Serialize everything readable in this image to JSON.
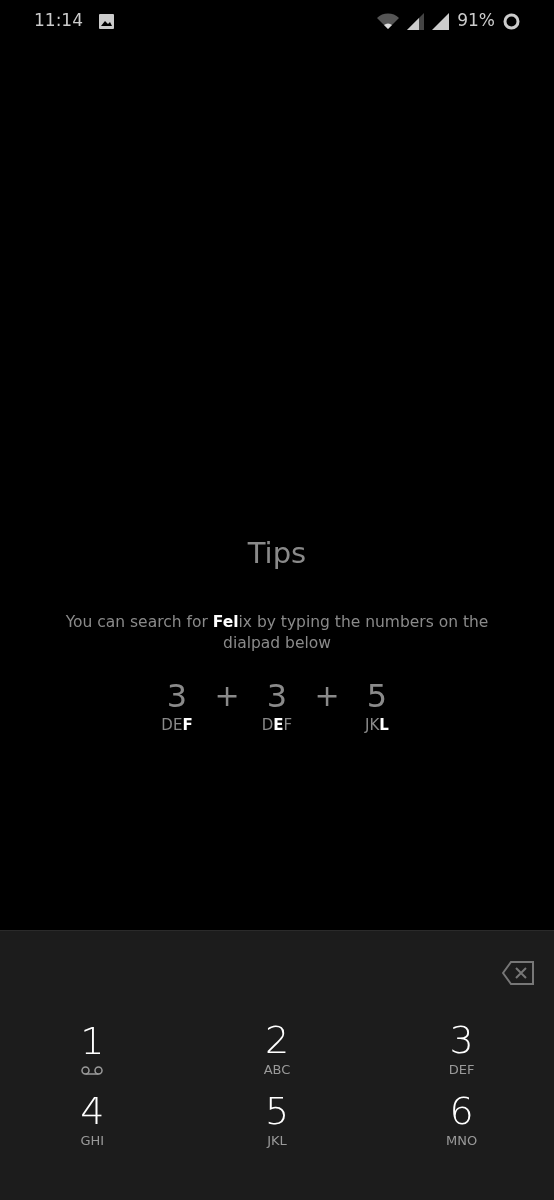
{
  "status_bar": {
    "time": "11:14",
    "battery": "91%"
  },
  "tips": {
    "title": "Tips",
    "message": "You can search for **Fel**ix by typing the numbers on the dialpad below",
    "sequence": [
      {
        "digit": "3",
        "letters": "DE**F**"
      },
      {
        "digit": "3",
        "letters": "D**E**F"
      },
      {
        "digit": "5",
        "letters": "JK**L**"
      }
    ],
    "joiner": [
      "+",
      "+"
    ]
  },
  "dialpad": {
    "keys": [
      {
        "digit": "1",
        "kind": "voicemail"
      },
      {
        "digit": "2",
        "kind": "letters",
        "letters": "ABC"
      },
      {
        "digit": "3",
        "kind": "letters",
        "letters": "DEF"
      },
      {
        "digit": "4",
        "kind": "letters",
        "letters": "GHI"
      },
      {
        "digit": "5",
        "kind": "letters",
        "letters": "JKL"
      },
      {
        "digit": "6",
        "kind": "letters",
        "letters": "MNO"
      }
    ]
  }
}
